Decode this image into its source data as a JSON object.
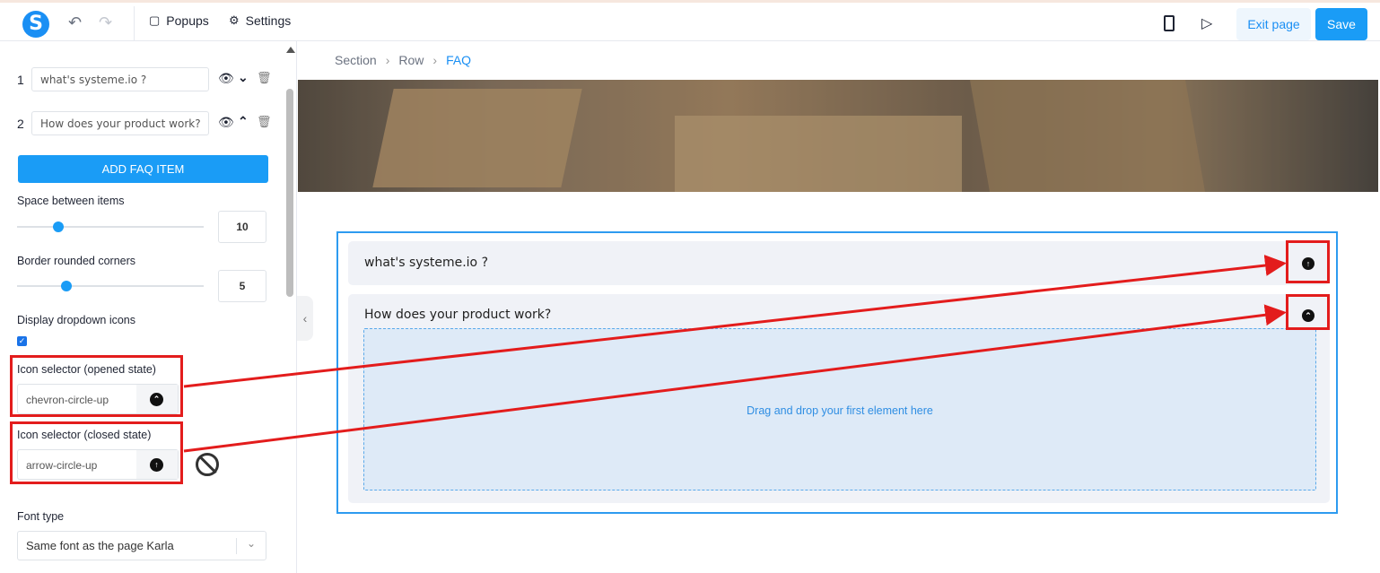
{
  "toolbar": {
    "logo": "S",
    "popups_label": "Popups",
    "settings_label": "Settings",
    "exit_label": "Exit page",
    "save_label": "Save"
  },
  "sidebar": {
    "faq_items": [
      {
        "number": "1",
        "value": "what's systeme.io ?"
      },
      {
        "number": "2",
        "value": "How does your product work?"
      }
    ],
    "add_button": "ADD FAQ ITEM",
    "space_label": "Space between items",
    "space_value": "10",
    "border_label": "Border rounded corners",
    "border_value": "5",
    "dropdown_icons_label": "Display dropdown icons",
    "icon_open_label": "Icon selector (opened state)",
    "icon_open_value": "chevron-circle-up",
    "icon_closed_label": "Icon selector (closed state)",
    "icon_closed_value": "arrow-circle-up",
    "font_type_label": "Font type",
    "font_type_value": "Same font as the page Karla"
  },
  "breadcrumb": {
    "items": [
      "Section",
      "Row",
      "FAQ"
    ]
  },
  "canvas": {
    "faq_questions": [
      "what's systeme.io ?",
      "How does your product work?"
    ],
    "dropzone_text": "Drag and drop your first element here"
  },
  "colors": {
    "accent": "#1a9cf6",
    "annotation": "#e31c1c"
  }
}
